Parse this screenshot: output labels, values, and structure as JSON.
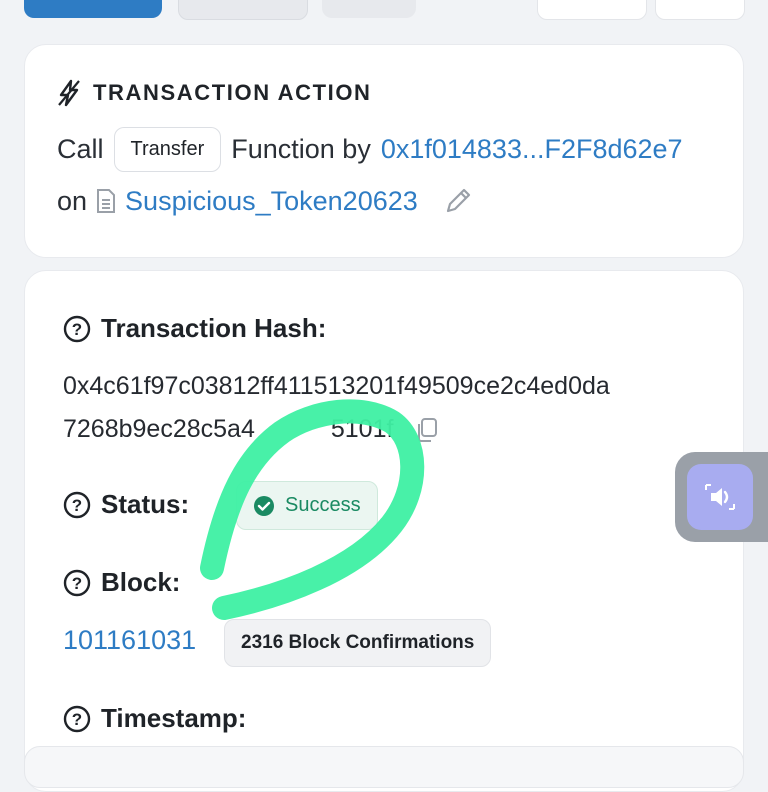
{
  "action": {
    "title": "TRANSACTION ACTION",
    "call_word": "Call",
    "function_name": "Transfer",
    "function_by": "Function by",
    "from_address": "0x1f014833...F2F8d62e7",
    "on_word": "on",
    "contract_name": "Suspicious_Token20623"
  },
  "details": {
    "hash_label": "Transaction Hash:",
    "hash_line1": "0x4c61f97c03812ff411513201f49509ce2c4ed0da",
    "hash_line2": "7268b9ec28c5a4",
    "hash_line2_end": "5101f",
    "status_label": "Status:",
    "status_value": "Success",
    "block_label": "Block:",
    "block_number": "101161031",
    "block_confirmations": "2316 Block Confirmations",
    "timestamp_label": "Timestamp:"
  },
  "colors": {
    "link": "#2e7cc4",
    "success_text": "#1a8a62",
    "success_bg": "#ebf6f1",
    "highlight_stroke": "#3ef0a3"
  },
  "icons": [
    "lightning-icon",
    "document-icon",
    "pencil-icon",
    "question-icon",
    "copy-icon",
    "check-circle-icon",
    "speaker-icon"
  ]
}
